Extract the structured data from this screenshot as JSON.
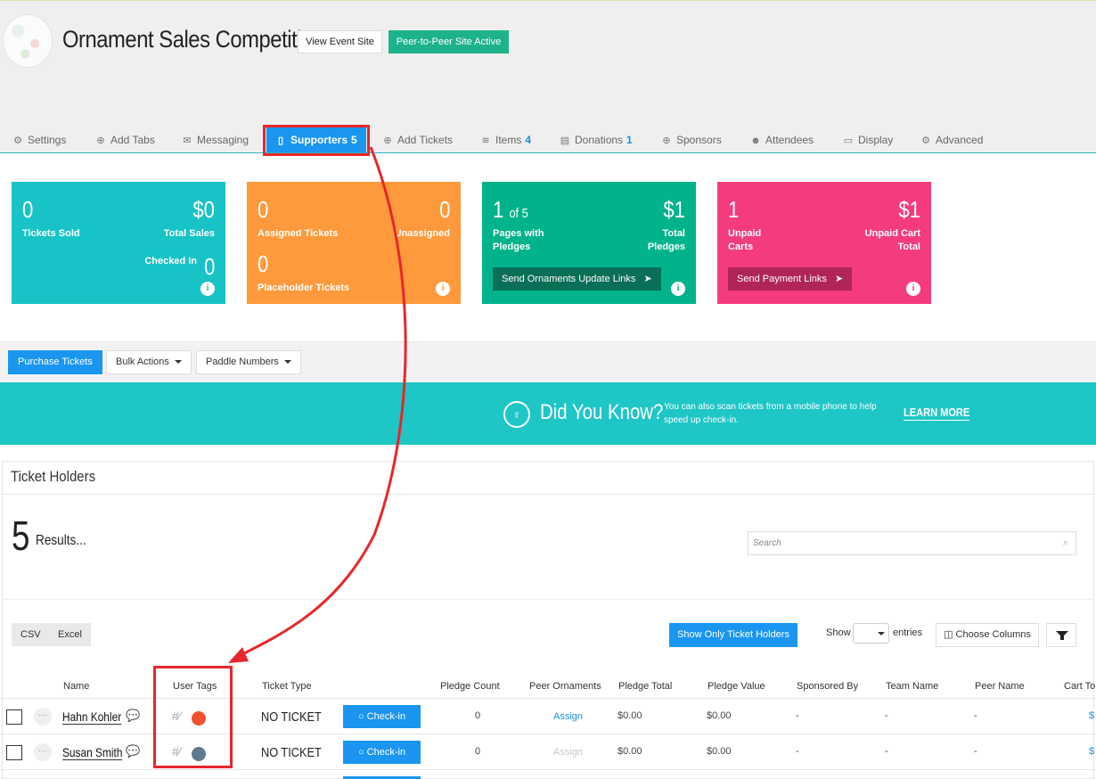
{
  "event": {
    "title": "Ornament Sales Competition",
    "view_site_label": "View Event Site",
    "p2p_label": "Peer-to-Peer Site Active"
  },
  "tabs": [
    {
      "label": "Settings",
      "icon": "gear-icon",
      "glyph": "⚙",
      "count": ""
    },
    {
      "label": "Add Tabs",
      "icon": "plus-circle-icon",
      "glyph": "⊕",
      "count": ""
    },
    {
      "label": "Messaging",
      "icon": "inbox-icon",
      "glyph": "✉",
      "count": ""
    },
    {
      "label": "Supporters",
      "icon": "clipboard-icon",
      "glyph": "▯",
      "count": "5"
    },
    {
      "label": "Add Tickets",
      "icon": "plus-circle-icon",
      "glyph": "⊕",
      "count": ""
    },
    {
      "label": "Items",
      "icon": "layers-icon",
      "glyph": "≋",
      "count": "4"
    },
    {
      "label": "Donations",
      "icon": "receipt-icon",
      "glyph": "▤",
      "count": "1"
    },
    {
      "label": "Sponsors",
      "icon": "plus-circle-icon",
      "glyph": "⊕",
      "count": ""
    },
    {
      "label": "Attendees",
      "icon": "users-icon",
      "glyph": "☻",
      "count": ""
    },
    {
      "label": "Display",
      "icon": "monitor-icon",
      "glyph": "▭",
      "count": ""
    },
    {
      "label": "Advanced",
      "icon": "cogs-icon",
      "glyph": "⚙",
      "count": ""
    }
  ],
  "cards": {
    "tickets": {
      "value": "0",
      "label": "Tickets Sold",
      "total_value": "$0",
      "total_label": "Total Sales",
      "checked_label": "Checked In",
      "checked_value": "0",
      "color": "#17c3c6"
    },
    "assigned": {
      "value": "0",
      "label": "Assigned Tickets",
      "unassigned_value": "0",
      "unassigned_label": "Unassigned",
      "placeholder_value": "0",
      "placeholder_label": "Placeholder Tickets",
      "color": "#ff9a3c"
    },
    "pledges": {
      "value": "1",
      "of_text": "of 5",
      "label": "Pages with Pledges",
      "total_value": "$1",
      "total_label": "Total Pledges",
      "button": "Send Ornaments Update Links",
      "color": "#00b38b"
    },
    "carts": {
      "value": "1",
      "label": "Unpaid Carts",
      "total_value": "$1",
      "total_label": "Unpaid Cart Total",
      "button": "Send Payment Links",
      "color": "#f33b7e"
    }
  },
  "toolbar": {
    "purchase": "Purchase Tickets",
    "bulk": "Bulk Actions",
    "paddle": "Paddle Numbers"
  },
  "banner": {
    "title": "Did You Know?",
    "text": "You can also scan tickets from a mobile phone to help speed up check-in.",
    "link": "LEARN MORE"
  },
  "holders": {
    "title": "Ticket Holders",
    "count": "5",
    "results_label": "Results...",
    "search_placeholder": "Search",
    "csv": "CSV",
    "excel": "Excel",
    "show_only": "Show Only Ticket Holders",
    "show_label": "Show",
    "entries_label": "entries",
    "choose_columns": "Choose Columns",
    "columns": [
      "Name",
      "User Tags",
      "Ticket Type",
      "Pledge Count",
      "Peer Ornaments",
      "Pledge Total",
      "Pledge Value",
      "Sponsored By",
      "Team Name",
      "Peer Name",
      "Cart To"
    ],
    "rows": [
      {
        "name": "Hahn Kohler",
        "tag_color": "#f0512e",
        "ticket_type": "NO TICKET",
        "checkin": "Check-in",
        "pledge_count": "0",
        "peer_ornaments": "Assign",
        "pledge_total": "$0.00",
        "pledge_value": "$0.00",
        "sponsored_by": "-",
        "team_name": "-",
        "peer_name": "-",
        "cart_total": "$"
      },
      {
        "name": "Susan Smith",
        "tag_color": "#5f7a8e",
        "ticket_type": "NO TICKET",
        "checkin": "Check-in",
        "pledge_count": "0",
        "peer_ornaments": "Assign",
        "pledge_total": "$0.00",
        "pledge_value": "$0.00",
        "sponsored_by": "-",
        "team_name": "-",
        "peer_name": "-",
        "cart_total": "$"
      }
    ]
  }
}
